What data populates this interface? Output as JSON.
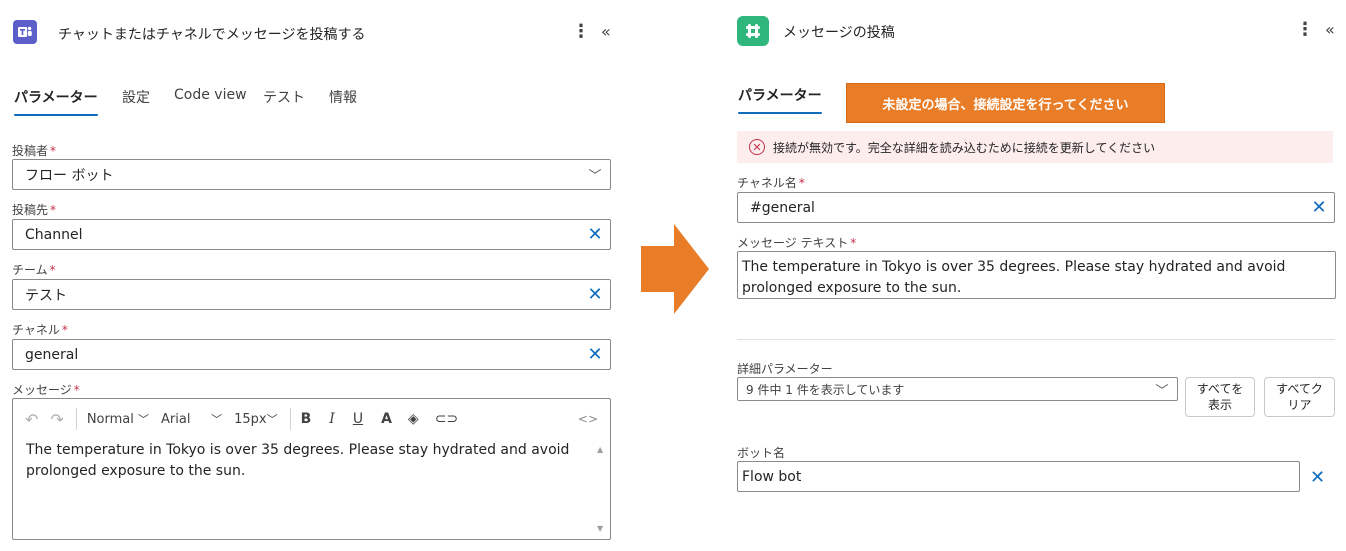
{
  "colors": {
    "accent": "#0f6cbd",
    "teams_icon": "#5b5fc7",
    "slack_icon": "#2eb67d",
    "arrow": "#e97d27",
    "banner": "#e97d27",
    "error_bg": "#fdeded",
    "required": "#c4314b"
  },
  "left": {
    "app_icon": "teams-icon",
    "title": "チャットまたはチャネルでメッセージを投稿する",
    "tabs": [
      "パラメーター",
      "設定",
      "Code view",
      "テスト",
      "情報"
    ],
    "active_tab": "パラメーター",
    "fields": {
      "poster": {
        "label": "投稿者",
        "required": "*",
        "value": "フロー ボット"
      },
      "post_in": {
        "label": "投稿先",
        "required": "*",
        "value": "Channel"
      },
      "team": {
        "label": "チーム",
        "required": "*",
        "value": "テスト"
      },
      "channel": {
        "label": "チャネル",
        "required": "*",
        "value": "general"
      },
      "message": {
        "label": "メッセージ",
        "required": "*"
      }
    },
    "toolbar": {
      "format": "Normal",
      "font": "Arial",
      "size": "15px"
    },
    "message_text": "The temperature in Tokyo is over 35 degrees. Please stay hydrated and avoid prolonged exposure to the sun."
  },
  "right": {
    "app_icon": "slack-icon",
    "title": "メッセージの投稿",
    "tab": "パラメーター",
    "banner": "未設定の場合、接続設定を行ってください",
    "error": "接続が無効です。完全な詳細を読み込むために接続を更新してください",
    "channel_name": {
      "label": "チャネル名",
      "required": "*",
      "value": "#general"
    },
    "message_text": {
      "label": "メッセージ テキスト",
      "required": "*",
      "value": "The temperature in Tokyo is over 35 degrees. Please stay hydrated and avoid prolonged exposure to the sun."
    },
    "advanced": {
      "label": "詳細パラメーター",
      "value": "9 件中 1 件を表示しています",
      "show_all": "すべてを表示",
      "clear_all": "すべてクリア"
    },
    "bot_name": {
      "label": "ボット名",
      "value": "Flow bot"
    }
  }
}
